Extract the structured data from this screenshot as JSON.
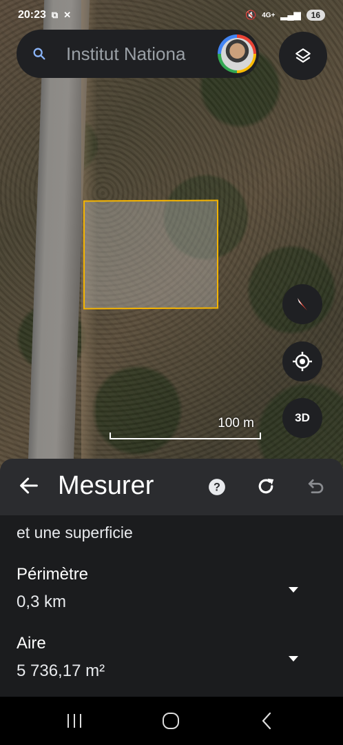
{
  "status_bar": {
    "time": "20:23",
    "network": "4G+",
    "battery": "16"
  },
  "search": {
    "text": "Institut Nationa"
  },
  "map": {
    "scale_label": "100 m",
    "three_d_label": "3D",
    "polygon_color": "#f5b400"
  },
  "panel": {
    "title": "Mesurer",
    "intro_text": "et une superficie",
    "perimeter": {
      "label": "Périmètre",
      "value": "0,3 km"
    },
    "area": {
      "label": "Aire",
      "value": "5 736,17 m²"
    }
  },
  "icons": {
    "search": "search-icon",
    "layers": "layers-icon",
    "compass": "compass-icon",
    "location": "my-location-icon",
    "back": "arrow-back-icon",
    "help": "help-icon",
    "refresh": "refresh-icon",
    "undo": "undo-icon"
  }
}
